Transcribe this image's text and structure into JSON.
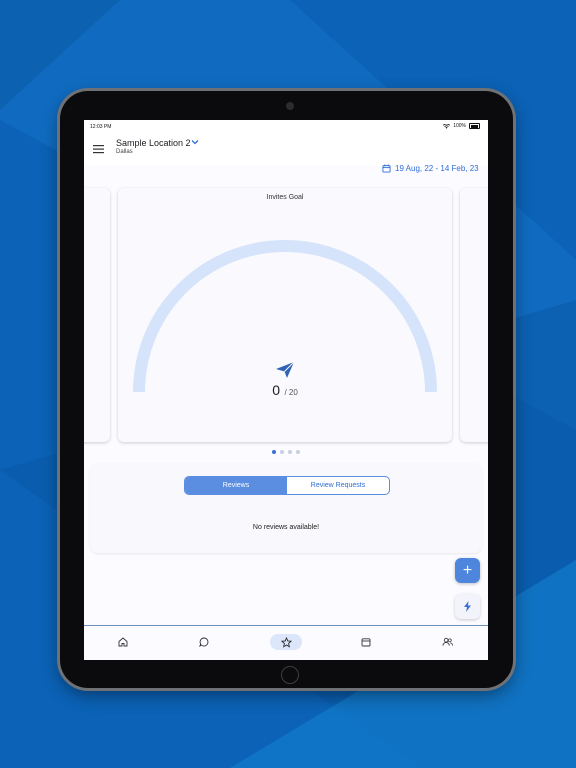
{
  "status_bar": {
    "time": "12:03 PM",
    "battery": "100%"
  },
  "header": {
    "location_name": "Sample Location 2",
    "location_city": "Dallas"
  },
  "date_range": "19 Aug, 22 - 14 Feb, 23",
  "goal_card": {
    "title": "Invites Goal",
    "current": "0",
    "separator": "/ 20",
    "progress": 0
  },
  "carousel": {
    "page_count": 4,
    "active_page": 0
  },
  "reviews": {
    "tabs": [
      {
        "label": "Reviews",
        "active": true
      },
      {
        "label": "Review Requests",
        "active": false
      }
    ],
    "empty_message": "No reviews available!"
  },
  "fab": {
    "add_symbol": "+",
    "quick_action_icon": "lightning-icon"
  },
  "bottom_nav": {
    "items": [
      {
        "icon": "home-icon",
        "active": false
      },
      {
        "icon": "chat-icon",
        "active": false
      },
      {
        "icon": "star-icon",
        "active": true
      },
      {
        "icon": "calendar-icon",
        "active": false
      },
      {
        "icon": "people-icon",
        "active": false
      }
    ]
  },
  "colors": {
    "accent": "#2f6fd6",
    "gauge_track": "#d6e4fb",
    "background": "#0a63b8"
  }
}
